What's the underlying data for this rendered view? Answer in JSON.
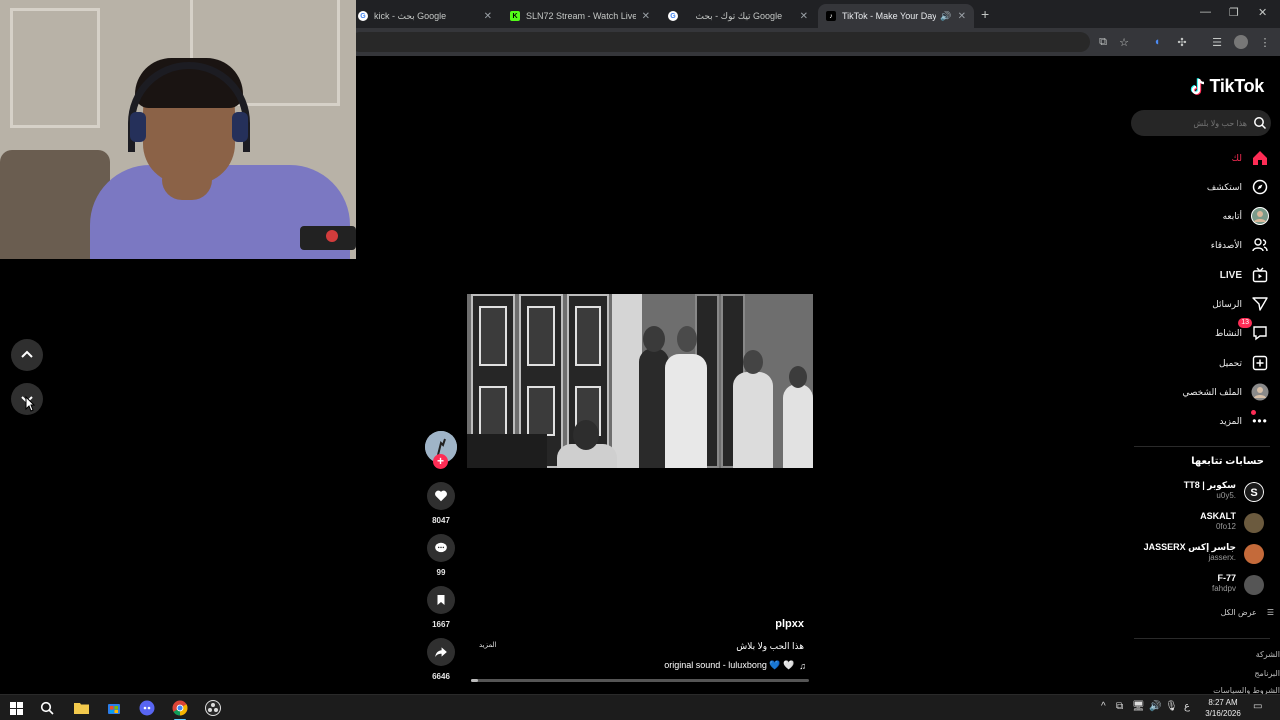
{
  "browser": {
    "tabs": [
      {
        "title": "kick - بحث Google",
        "favicon": "google-icon"
      },
      {
        "title": "SLN72 Stream - Watch Live on",
        "favicon": "kick-icon"
      },
      {
        "title": "تيك توك - بحث Google",
        "favicon": "google-icon"
      },
      {
        "title": "TikTok - Make Your Day",
        "favicon": "tiktok-icon",
        "active": true
      }
    ],
    "new_tab": "+"
  },
  "sidebar": {
    "logo": "TikTok",
    "search_placeholder": "هذا حب ولا بلش",
    "nav": [
      {
        "label": "لك",
        "icon": "home-icon",
        "active": true
      },
      {
        "label": "استكشف",
        "icon": "compass-icon"
      },
      {
        "label": "أتابعه",
        "icon": "avatar-icon"
      },
      {
        "label": "الأصدقاء",
        "icon": "friends-icon"
      },
      {
        "label": "LIVE",
        "icon": "live-icon"
      },
      {
        "label": "الرسائل",
        "icon": "send-icon"
      },
      {
        "label": "النشاط",
        "icon": "activity-icon",
        "badge": "13"
      },
      {
        "label": "تحميل",
        "icon": "upload-icon"
      },
      {
        "label": "الملف الشخصي",
        "icon": "profile-icon"
      },
      {
        "label": "المزيد",
        "icon": "more-icon"
      }
    ],
    "following_title": "حسابات تتابعها",
    "following": [
      {
        "name": "سكوبر | TT8",
        "handle": "u0y5.",
        "avatar_color": "#2b2b2b"
      },
      {
        "name": "ASKALT",
        "handle": "0fo12",
        "avatar_color": "#6b5a3e"
      },
      {
        "name": "جاسر إكس JASSERX",
        "handle": "jasserx.",
        "avatar_color": "#c46a3a"
      },
      {
        "name": "F-77",
        "handle": "fahdpv",
        "avatar_color": "#555555"
      }
    ],
    "see_all": "عرض الكل",
    "footer": [
      "الشركة",
      "البرنامج",
      "الشروط والسياسات"
    ]
  },
  "video": {
    "username": "plpxx",
    "description": "هذا الحب ولا بلاش",
    "more": "المزيد",
    "sound": "original sound - luluxbong 💙 🤍",
    "progress": 0.02
  },
  "actions": {
    "likes": "8047",
    "comments": "99",
    "saves": "1667",
    "shares": "6646"
  },
  "taskbar": {
    "time": "8:27 AM",
    "date": "3/16/2026",
    "lang": "ع"
  },
  "colors": {
    "accent": "#fe2c55",
    "tiktok_cyan": "#25f4ee",
    "taskbar_active": "#60cdff"
  }
}
